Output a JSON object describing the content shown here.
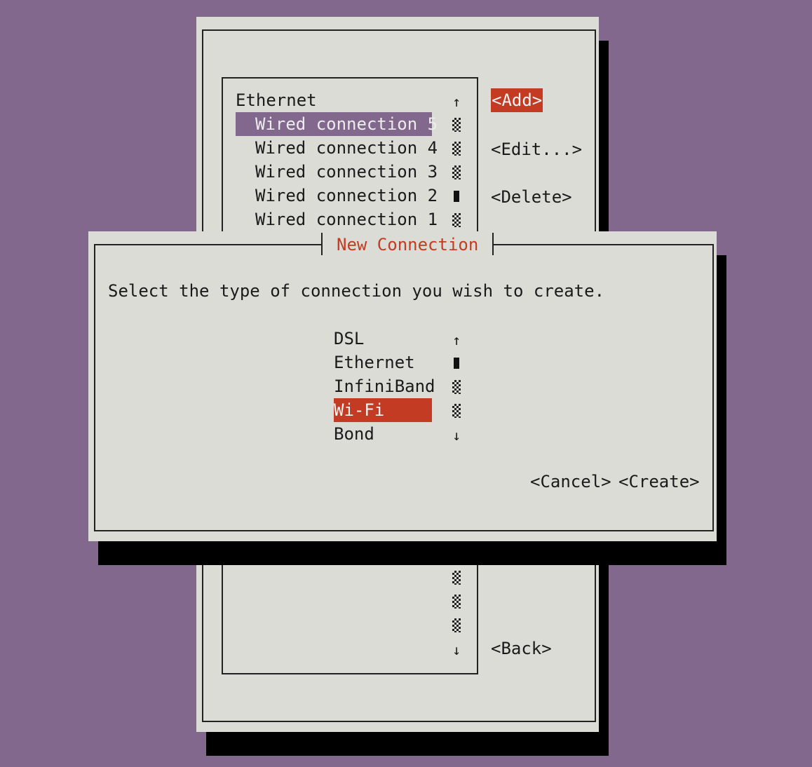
{
  "background_color": "#82688c",
  "accent_color": "#c23b22",
  "selection_color": "#82688c",
  "connections": {
    "group_label": "Ethernet",
    "items": [
      "Wired connection 5",
      "Wired connection 4",
      "Wired connection 3",
      "Wired connection 2",
      "Wired connection 1"
    ],
    "selected": "Wired connection 5",
    "scroll_up": "↑",
    "scroll_down": "↓",
    "buttons": {
      "add": "<Add>",
      "edit": "<Edit...>",
      "delete": "<Delete>",
      "back": "<Back>"
    }
  },
  "dialog": {
    "title": "New Connection",
    "prompt": "Select the type of connection you wish to create.",
    "scroll_up": "↑",
    "scroll_down": "↓",
    "types": [
      "DSL",
      "Ethernet",
      "InfiniBand",
      "Wi-Fi",
      "Bond"
    ],
    "selected": "Wi-Fi",
    "buttons": {
      "cancel": "<Cancel>",
      "create": "<Create>"
    }
  }
}
